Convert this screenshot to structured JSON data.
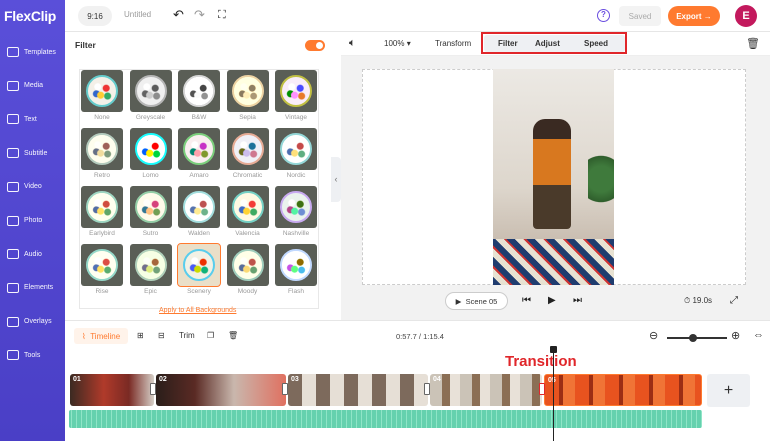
{
  "app": {
    "logo": "FlexClip"
  },
  "sidebar": {
    "items": [
      {
        "label": "Templates",
        "icon": "templates-icon"
      },
      {
        "label": "Media",
        "icon": "media-icon"
      },
      {
        "label": "Text",
        "icon": "text-icon"
      },
      {
        "label": "Subtitle",
        "icon": "subtitle-icon"
      },
      {
        "label": "Video",
        "icon": "video-icon"
      },
      {
        "label": "Photo",
        "icon": "photo-icon"
      },
      {
        "label": "Audio",
        "icon": "audio-icon"
      },
      {
        "label": "Elements",
        "icon": "elements-icon"
      },
      {
        "label": "Overlays",
        "icon": "overlays-icon"
      },
      {
        "label": "Tools",
        "icon": "tools-icon"
      }
    ]
  },
  "topbar": {
    "ratio": "9:16",
    "title": "Untitled",
    "saved": "Saved",
    "export": "Export →",
    "avatar": "E",
    "help": "?"
  },
  "panel": {
    "title": "Filter",
    "apply_all": "Apply to All Backgrounds",
    "filters": [
      "None",
      "Greyscale",
      "B&W",
      "Sepia",
      "Vintage",
      "Retro",
      "Lomo",
      "Amaro",
      "Chromatic",
      "Nordic",
      "Earlybird",
      "Sutro",
      "Walden",
      "Valencia",
      "Nashville",
      "Rise",
      "Epic",
      "Scenery",
      "Moody",
      "Flash"
    ]
  },
  "toolbar": {
    "zoom": "100%",
    "transform": "Transform",
    "filter": "Filter",
    "adjust": "Adjust",
    "speed": "Speed"
  },
  "player": {
    "scene": "Scene 05",
    "duration": "19.0s"
  },
  "timeline": {
    "label": "Timeline",
    "trim": "Trim",
    "time": "0:57.7 / 1:15.4",
    "transition_label": "Transition",
    "clips": [
      "01",
      "02",
      "03",
      "04",
      "05"
    ]
  },
  "colors": {
    "accent": "#ff7a2f",
    "sidebar": "#4a3fc6",
    "highlight": "#e0262a"
  }
}
